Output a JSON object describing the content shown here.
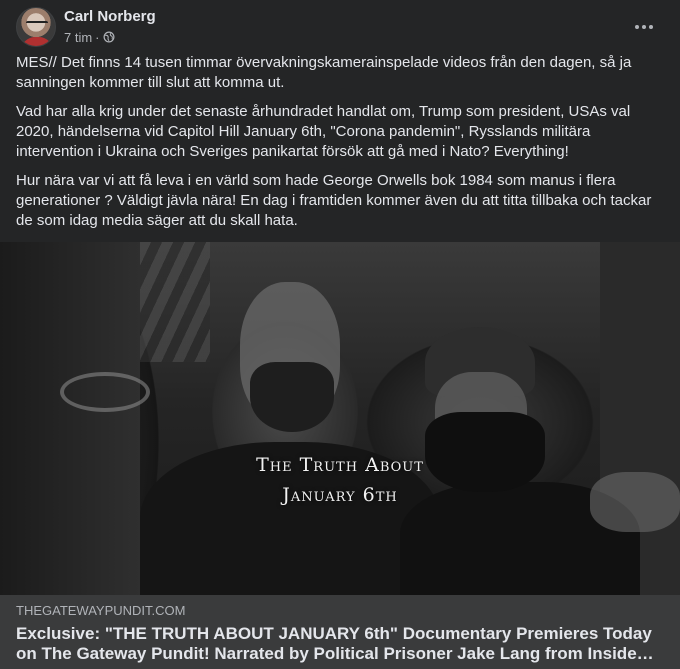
{
  "post": {
    "author": "Carl Norberg",
    "time": "7 tim",
    "separator": "·",
    "privacy_icon": "globe-icon",
    "more_icon": "more-options-icon",
    "paragraphs": [
      "MES// Det finns 14 tusen timmar övervakningskamerainspelade videos från den dagen, så ja sanningen kommer till slut att komma ut.",
      "Vad har alla krig under det senaste århundradet handlat om,  Trump som president, USAs val 2020, händelserna vid Capitol Hill  January 6th, \"Corona pandemin\",  Rysslands militära intervention i Ukraina och Sveriges panikartat försök att gå med  i Nato? Everything!",
      "Hur nära var vi att få leva i en värld som hade George Orwells bok 1984 som manus i flera generationer ? Väldigt jävla nära! En dag i framtiden kommer även du att titta tillbaka och tackar de som idag media säger att du skall hata."
    ]
  },
  "link_preview": {
    "image_title_line1": "The Truth About",
    "image_title_line2": "January 6th",
    "domain": "THEGATEWAYPUNDIT.COM",
    "headline": "Exclusive: \"THE TRUTH ABOUT JANUARY 6th\" Documentary Premieres Today on The Gateway Pundit! Narrated by Political Prisoner Jake Lang from Inside…"
  },
  "colors": {
    "background": "#242526",
    "link_footer": "#3a3b3c",
    "primary_text": "#e4e6eb",
    "secondary_text": "#b0b3b8"
  }
}
